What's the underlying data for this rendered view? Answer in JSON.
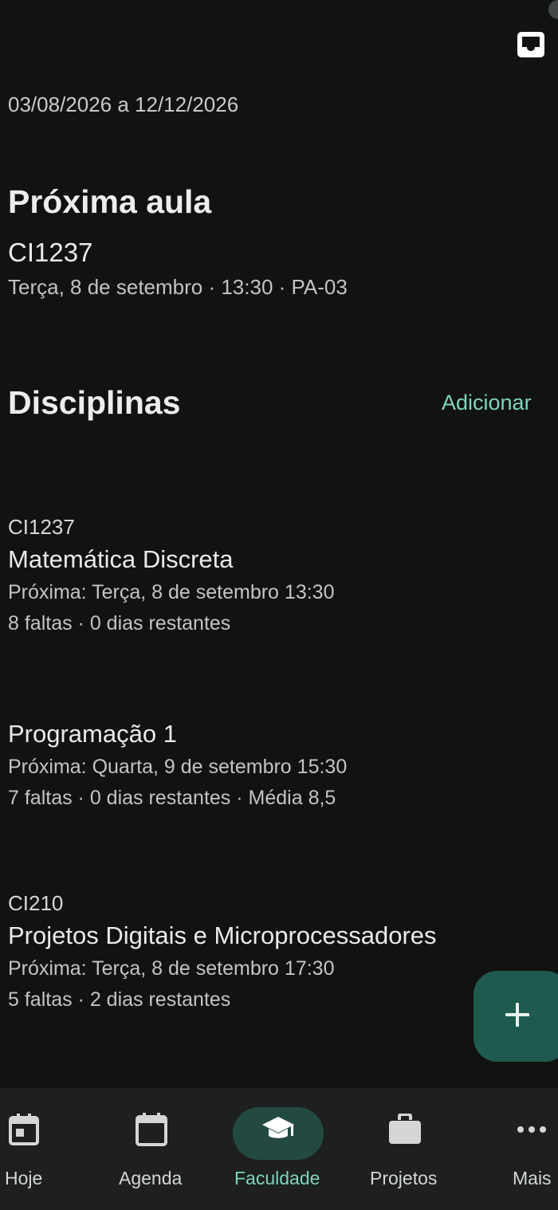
{
  "header": {
    "period": "03/08/2026 a 12/12/2026"
  },
  "next_class": {
    "heading": "Próxima aula",
    "code": "CI1237",
    "info": "Terça, 8 de setembro · 13:30 · PA-03"
  },
  "courses_section": {
    "heading": "Disciplinas",
    "add_label": "Adicionar",
    "items": [
      {
        "code": "CI1237",
        "name": "Matemática Discreta",
        "next": "Próxima: Terça, 8 de setembro 13:30",
        "stats": "8 faltas · 0 dias restantes"
      },
      {
        "code": "",
        "name": "Programação 1",
        "next": "Próxima: Quarta, 9 de setembro 15:30",
        "stats": "7 faltas · 0 dias restantes · Média 8,5"
      },
      {
        "code": "CI210",
        "name": "Projetos Digitais e Microprocessadores",
        "next": "Próxima: Terça, 8 de setembro 17:30",
        "stats": "5 faltas · 2 dias restantes"
      }
    ]
  },
  "nav": {
    "items": [
      {
        "label": "Hoje",
        "icon": "calendar-today-icon"
      },
      {
        "label": "Agenda",
        "icon": "calendar-icon"
      },
      {
        "label": "Faculdade",
        "icon": "graduation-cap-icon",
        "active": true
      },
      {
        "label": "Projetos",
        "icon": "briefcase-icon"
      },
      {
        "label": "Mais",
        "icon": "more-horizontal-icon"
      }
    ]
  },
  "colors": {
    "background": "#111312",
    "accent": "#7fd4bd",
    "fab": "#1f5a4f",
    "nav_background": "#1d201f",
    "nav_active_pill": "#234a41"
  }
}
